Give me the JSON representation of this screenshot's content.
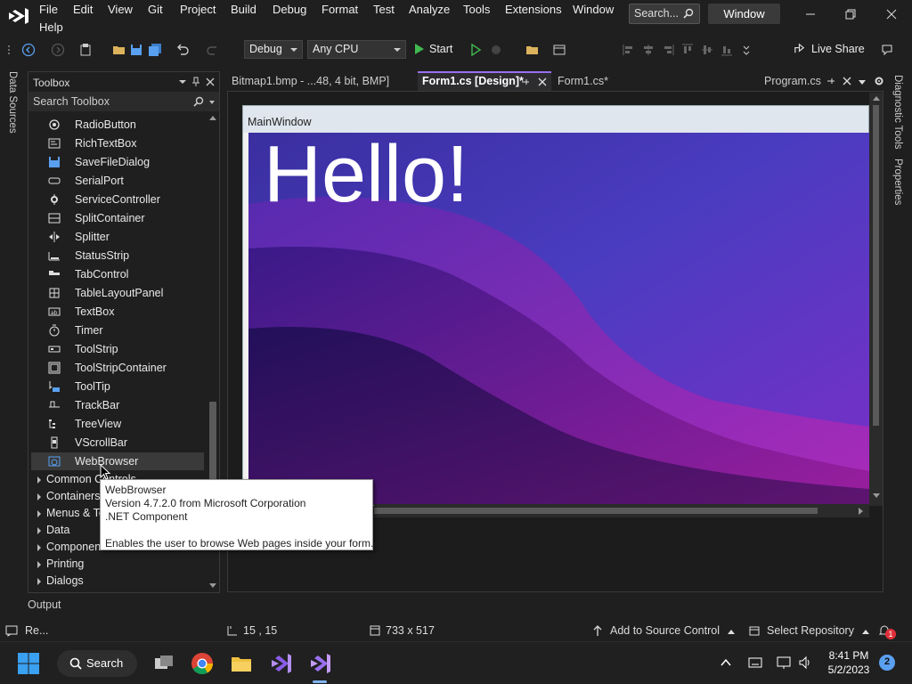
{
  "menubar": {
    "items": [
      "File",
      "Edit",
      "View",
      "Git",
      "Project",
      "Build",
      "Debug",
      "Format",
      "Test",
      "Analyze",
      "Tools",
      "Extensions",
      "Window",
      "Help"
    ],
    "search_placeholder": "Search...",
    "window_title": "Window"
  },
  "toolbar": {
    "configuration": "Debug",
    "platform": "Any CPU",
    "start_label": "Start",
    "live_share": "Live Share"
  },
  "left_strip": {
    "label": "Data Sources"
  },
  "right_strip": {
    "labels": [
      "Diagnostic Tools",
      "Properties"
    ]
  },
  "toolbox": {
    "title": "Toolbox",
    "search_placeholder": "Search Toolbox",
    "items": [
      {
        "label": "RadioButton",
        "icon": "radio-icon"
      },
      {
        "label": "RichTextBox",
        "icon": "richtext-icon"
      },
      {
        "label": "SaveFileDialog",
        "icon": "save-dialog-icon"
      },
      {
        "label": "SerialPort",
        "icon": "serial-port-icon"
      },
      {
        "label": "ServiceController",
        "icon": "service-icon"
      },
      {
        "label": "SplitContainer",
        "icon": "split-container-icon"
      },
      {
        "label": "Splitter",
        "icon": "splitter-icon"
      },
      {
        "label": "StatusStrip",
        "icon": "status-strip-icon"
      },
      {
        "label": "TabControl",
        "icon": "tab-control-icon"
      },
      {
        "label": "TableLayoutPanel",
        "icon": "table-layout-icon"
      },
      {
        "label": "TextBox",
        "icon": "textbox-icon"
      },
      {
        "label": "Timer",
        "icon": "timer-icon"
      },
      {
        "label": "ToolStrip",
        "icon": "toolstrip-icon"
      },
      {
        "label": "ToolStripContainer",
        "icon": "toolstrip-container-icon"
      },
      {
        "label": "ToolTip",
        "icon": "tooltip-icon"
      },
      {
        "label": "TrackBar",
        "icon": "trackbar-icon"
      },
      {
        "label": "TreeView",
        "icon": "treeview-icon"
      },
      {
        "label": "VScrollBar",
        "icon": "vscrollbar-icon"
      },
      {
        "label": "WebBrowser",
        "icon": "webbrowser-icon"
      }
    ],
    "categories": [
      "Common Controls",
      "Containers",
      "Menus & Toolbars",
      "Data",
      "Components",
      "Printing",
      "Dialogs"
    ],
    "selected": "WebBrowser"
  },
  "tabs": [
    {
      "label": "Bitmap1.bmp - ...48, 4 bit, BMP]"
    },
    {
      "label": "Form1.cs [Design]*",
      "active": true
    },
    {
      "label": "Form1.cs*"
    },
    {
      "label": "Program.cs"
    }
  ],
  "designer": {
    "form_title": "MainWindow",
    "hello_text": "Hello!"
  },
  "tooltip": {
    "title": "WebBrowser",
    "version": "Version 4.7.2.0 from Microsoft Corporation",
    "kind": ".NET Component",
    "description": "Enables the user to browse Web pages inside your form."
  },
  "output": {
    "label": "Output"
  },
  "statusbar": {
    "ready": "Re...",
    "position": "15 , 15",
    "size": "733 x 517",
    "source_control": "Add to Source Control",
    "repository": "Select Repository",
    "notifications": "1"
  },
  "taskbar": {
    "search": "Search",
    "time": "8:41 PM",
    "date": "5/2/2023",
    "notification_count": "2"
  },
  "colors": {
    "accent": "#9a6ff0",
    "background": "#1f1f1f",
    "selection": "#3a3a3a"
  }
}
